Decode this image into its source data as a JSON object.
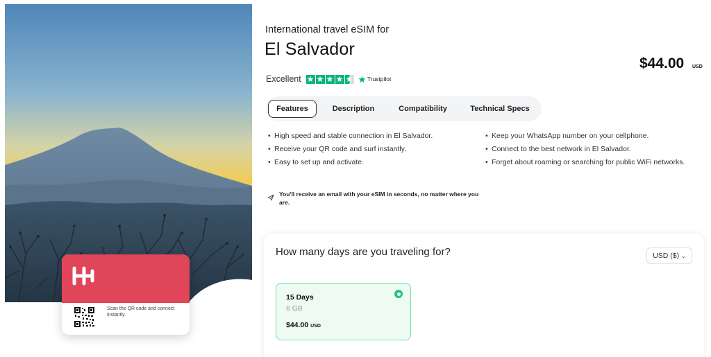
{
  "hero": {
    "image_description": "Sunset over a volcano with silhouetted branches"
  },
  "card": {
    "brand_logo": "holafly-logo",
    "qr_text": "Scan the QR code and connect instantly."
  },
  "product": {
    "subtitle": "International travel eSIM for",
    "title": "El Salvador",
    "price": "$44.00",
    "currency_code": "USD"
  },
  "rating": {
    "label": "Excellent",
    "stars": 4.5,
    "provider": "Trustpilot"
  },
  "tabs": [
    {
      "label": "Features",
      "active": true
    },
    {
      "label": "Description",
      "active": false
    },
    {
      "label": "Compatibility",
      "active": false
    },
    {
      "label": "Technical Specs",
      "active": false
    }
  ],
  "features_left": [
    "High speed and stable connection in El Salvador.",
    "Receive your QR code and surf instantly.",
    "Easy to set up and activate."
  ],
  "features_right": [
    "Keep your WhatsApp number on your cellphone.",
    "Connect to the best network in El Salvador.",
    "Forget about roaming or searching for public WiFi networks."
  ],
  "notice": "You'll receive an email with your eSIM in seconds, no matter where you are.",
  "days_panel": {
    "question": "How many days are you traveling for?",
    "currency_selector": "USD ($)",
    "plans": [
      {
        "days": "15 Days",
        "data": "6 GB",
        "price": "$44.00",
        "currency": "USD",
        "selected": true
      }
    ]
  },
  "colors": {
    "brand_red": "#e0455a",
    "trustpilot_green": "#00b67a",
    "selected_green": "#1ec47a"
  }
}
